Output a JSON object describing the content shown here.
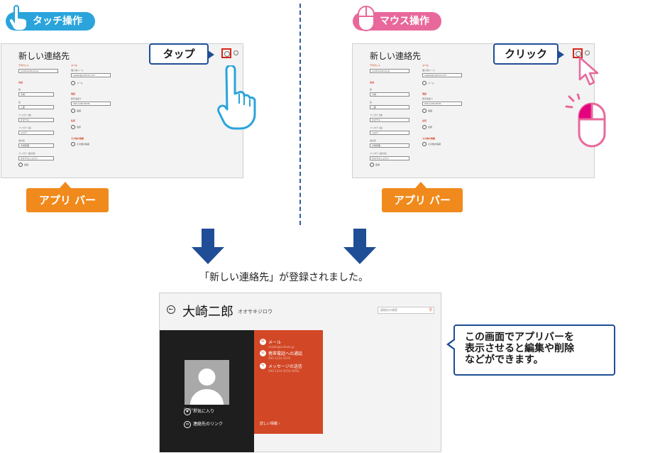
{
  "colors": {
    "touch": "#2aa4db",
    "mouse": "#e8689b",
    "accent_blue": "#1f4e96",
    "appbar_orange": "#f08a1c",
    "contact_orange": "#d24726",
    "highlight_red": "#d9261c"
  },
  "touch_tag": {
    "label": "タッチ操作",
    "icon": "hand-pointer-icon"
  },
  "mouse_tag": {
    "label": "マウス操作",
    "icon": "mouse-icon"
  },
  "form": {
    "title": "新しい連絡先",
    "account_label": "アカウント",
    "account_value": "jumitrxoutlook.jp",
    "name_label": "名前",
    "last_label": "姓",
    "last_value": "大崎",
    "first_label": "名",
    "first_value": "二郎",
    "kana_last_label": "フリガナ (姓)",
    "kana_last_value": "オオサキ",
    "kana_first_label": "フリガナ (名)",
    "kana_first_value": "ジロウ",
    "company_label": "会社名",
    "company_value": "大崎商事",
    "kana_company_label": "フリガナ (会社名)",
    "kana_company_value": "オオサキショウジ",
    "name_plus": "名前",
    "email_label": "メール",
    "email_sub": "個人用メール",
    "email_value": "osaaki@outlook.com",
    "email_plus": "メール",
    "phone_label": "電話",
    "phone_sub": "携帯電話 ▾",
    "phone_value": "090-1234-5678",
    "phone_plus": "電話",
    "address_label": "住所",
    "address_plus": "住所",
    "other_label": "その他の情報",
    "other_plus": "その他の情報"
  },
  "callouts": {
    "tap": "タップ",
    "click": "クリック"
  },
  "appbar_label": "アプリ バー",
  "result_text": "「新しい連絡先」が登録されました。",
  "contact": {
    "name": "大崎二郎",
    "kana": "オオサキジロウ",
    "search_placeholder": "連絡先の検索",
    "account": "Outlook",
    "mail_label": "メール",
    "mail_value": "osaaki@outlook.jp",
    "call_label": "携帯電話への通話",
    "call_value": "090-1234-5678",
    "sms_label": "メッセージの送信",
    "sms_value": "090-1234-5678 (SMS)",
    "more_info": "詳しい情報 ›",
    "favorite": "お気に入り",
    "link": "連絡先のリンク"
  },
  "note": [
    "この画面でアプリバーを",
    "表示させると編集や削除",
    "などができます。"
  ]
}
